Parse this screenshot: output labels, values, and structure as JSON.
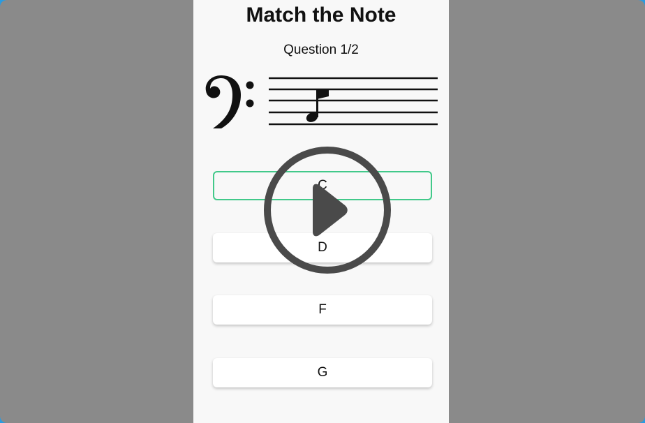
{
  "quiz": {
    "title": "Match the Note",
    "question_label": "Question 1/2",
    "current_question": 1,
    "total_questions": 2
  },
  "staff": {
    "clef": "bass-clef-icon",
    "note": "quarter-note-icon"
  },
  "answers": [
    {
      "label": "C",
      "selected": true
    },
    {
      "label": "D",
      "selected": false
    },
    {
      "label": "F",
      "selected": false
    },
    {
      "label": "G",
      "selected": false
    }
  ],
  "overlay": {
    "icon": "play-icon"
  },
  "colors": {
    "selected_border": "#42c98a",
    "overlay": "#4a4a4a",
    "backdrop": "#8a8a8a",
    "panel": "#f8f8f8"
  }
}
